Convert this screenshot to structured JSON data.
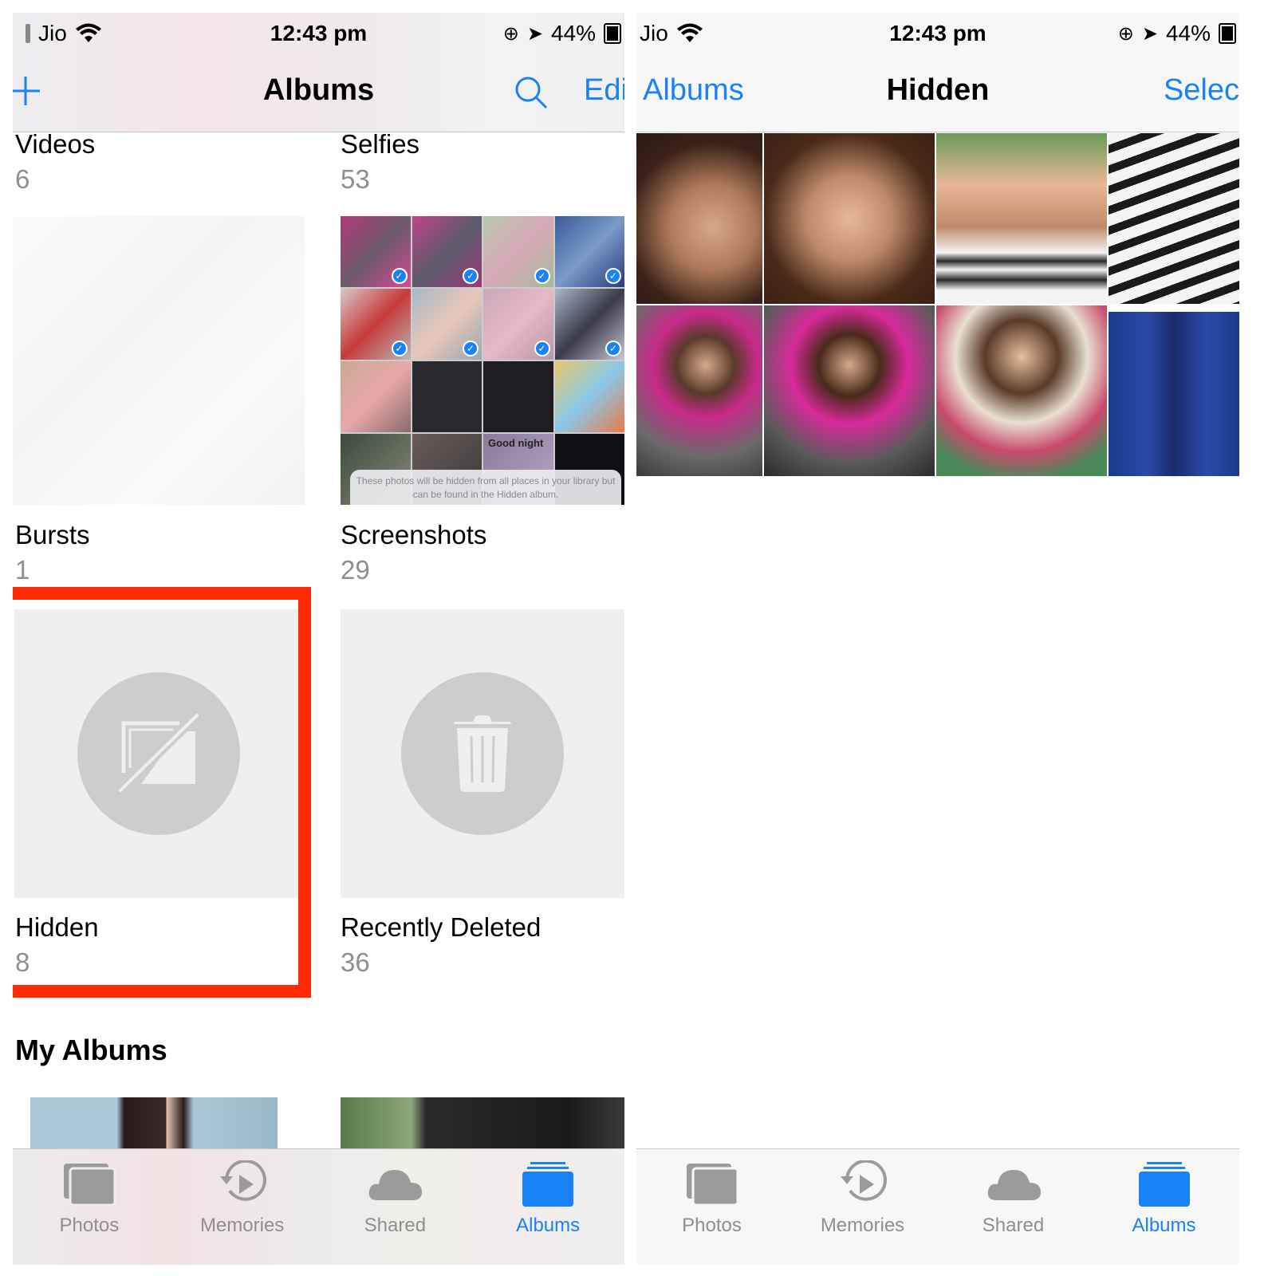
{
  "status_bar": {
    "carrier": "Jio",
    "time": "12:43 pm",
    "battery": "44%"
  },
  "left_screen": {
    "nav": {
      "title": "Albums",
      "add_icon": "plus-icon",
      "search_icon": "search-icon",
      "edit_label": "Edi"
    },
    "albums": [
      {
        "title": "Videos",
        "count": "6"
      },
      {
        "title": "Selfies",
        "count": "53"
      },
      {
        "title": "Bursts",
        "count": "1"
      },
      {
        "title": "Screenshots",
        "count": "29"
      },
      {
        "title": "Hidden",
        "count": "8",
        "icon": "hidden-photo-icon"
      },
      {
        "title": "Recently Deleted",
        "count": "36",
        "icon": "trash-icon"
      }
    ],
    "screenshot_tip": "These photos will be hidden from all places in your library but can be found in the Hidden album.",
    "screenshot_caption": "Good night",
    "section_title": "My Albums",
    "highlight_color": "#ff2a06"
  },
  "right_screen": {
    "nav": {
      "back_label": "Albums",
      "title": "Hidden",
      "select_label": "Selec"
    },
    "photo_count": 8
  },
  "tab_bar": {
    "tabs": [
      {
        "label": "Photos",
        "icon": "photos-icon"
      },
      {
        "label": "Memories",
        "icon": "memories-icon"
      },
      {
        "label": "Shared",
        "icon": "shared-cloud-icon"
      },
      {
        "label": "Albums",
        "icon": "albums-icon",
        "active": true
      }
    ]
  },
  "colors": {
    "accent": "#1a82f7",
    "inactive": "#8e8e93",
    "highlight": "#ff2a06"
  }
}
